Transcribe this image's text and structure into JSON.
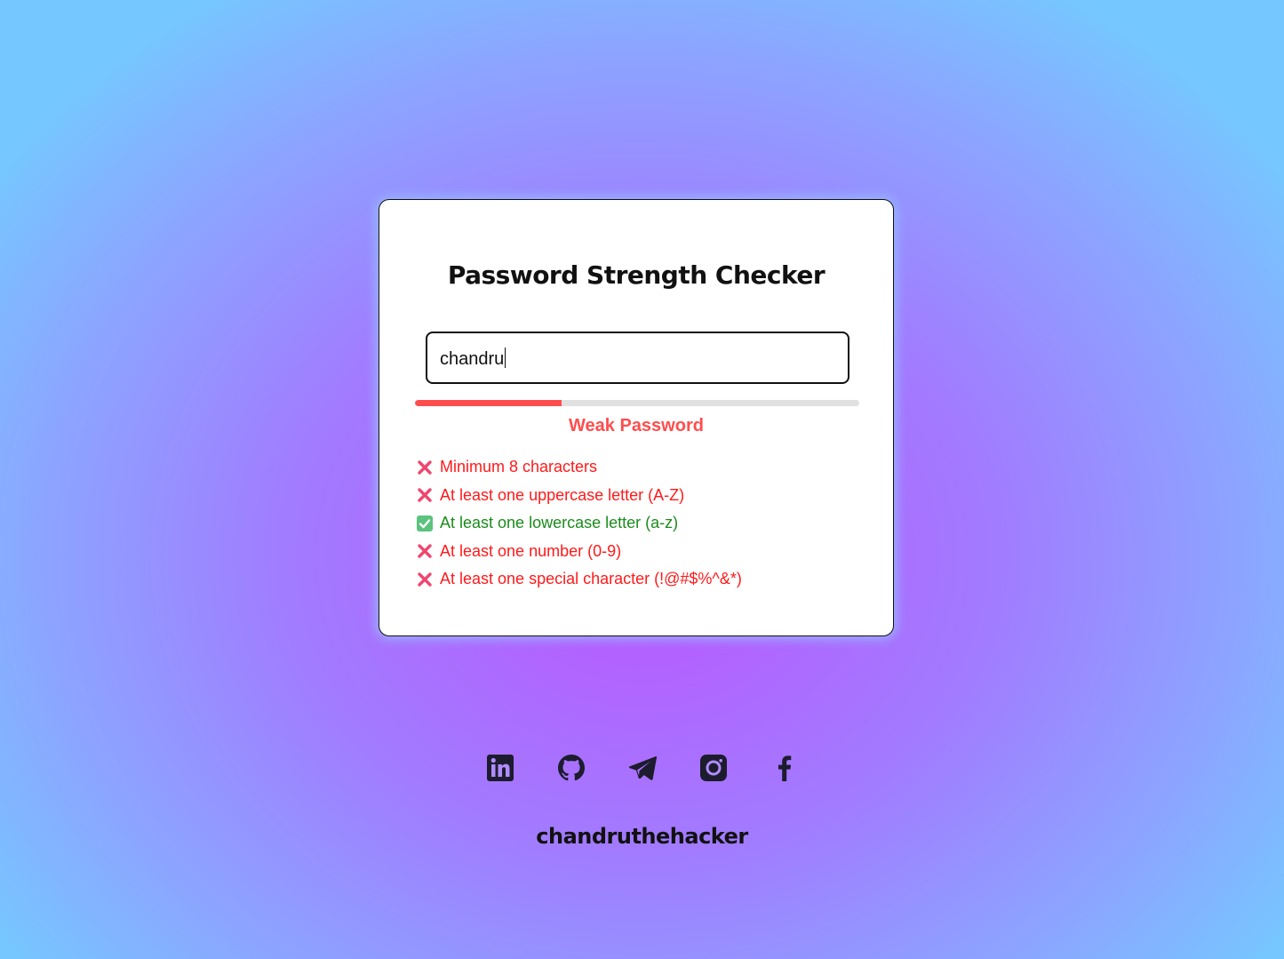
{
  "checker": {
    "title": "Password Strength Checker",
    "password_value": "chandru",
    "strength_label": "Weak Password",
    "strength_fraction": 0.33,
    "strength_color": "#ff4d4d",
    "rules": [
      {
        "text": "Minimum 8 characters",
        "met": false
      },
      {
        "text": "At least one uppercase letter (A-Z)",
        "met": false
      },
      {
        "text": "At least one lowercase letter (a-z)",
        "met": true
      },
      {
        "text": "At least one number (0-9)",
        "met": false
      },
      {
        "text": "At least one special character (!@#$%^&*)",
        "met": false
      }
    ]
  },
  "socials": [
    {
      "name": "linkedin",
      "icon": "linkedin-icon"
    },
    {
      "name": "github",
      "icon": "github-icon"
    },
    {
      "name": "telegram",
      "icon": "telegram-icon"
    },
    {
      "name": "instagram",
      "icon": "instagram-icon"
    },
    {
      "name": "facebook",
      "icon": "facebook-icon"
    }
  ],
  "footer": {
    "brand": "chandruthehacker"
  },
  "colors": {
    "fail": "#ff1a1a",
    "pass": "#1a8c1a",
    "icon": "#1c1c2e"
  }
}
